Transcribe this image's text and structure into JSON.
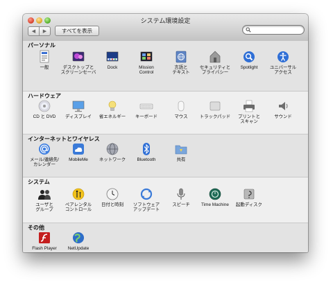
{
  "window": {
    "title": "システム環境設定"
  },
  "toolbar": {
    "back_glyph": "◀",
    "forward_glyph": "▶",
    "show_all_label": "すべてを表示",
    "search_value": ""
  },
  "sections": [
    {
      "title": "パーソナル",
      "items": [
        {
          "label": "一般",
          "icon": "general-icon"
        },
        {
          "label": "デスクトップと\nスクリーンセーバ",
          "icon": "desktop-screensaver-icon"
        },
        {
          "label": "Dock",
          "icon": "dock-icon"
        },
        {
          "label": "Mission\nControl",
          "icon": "mission-control-icon"
        },
        {
          "label": "言語と\nテキスト",
          "icon": "language-text-icon"
        },
        {
          "label": "セキュリティと\nプライバシー",
          "icon": "security-icon"
        },
        {
          "label": "Spotlight",
          "icon": "spotlight-icon"
        },
        {
          "label": "ユニバーサル\nアクセス",
          "icon": "universal-access-icon"
        }
      ]
    },
    {
      "title": "ハードウェア",
      "items": [
        {
          "label": "CD と DVD",
          "icon": "cd-dvd-icon"
        },
        {
          "label": "ディスプレイ",
          "icon": "display-icon"
        },
        {
          "label": "省エネルギー",
          "icon": "energy-saver-icon"
        },
        {
          "label": "キーボード",
          "icon": "keyboard-icon"
        },
        {
          "label": "マウス",
          "icon": "mouse-icon"
        },
        {
          "label": "トラックパッド",
          "icon": "trackpad-icon"
        },
        {
          "label": "プリントと\nスキャン",
          "icon": "print-scan-icon"
        },
        {
          "label": "サウンド",
          "icon": "sound-icon"
        }
      ]
    },
    {
      "title": "インターネットとワイヤレス",
      "items": [
        {
          "label": "メール/連絡先/\nカレンダー",
          "icon": "mail-contacts-icon"
        },
        {
          "label": "MobileMe",
          "icon": "mobileme-icon"
        },
        {
          "label": "ネットワーク",
          "icon": "network-icon"
        },
        {
          "label": "Bluetooth",
          "icon": "bluetooth-icon"
        },
        {
          "label": "共有",
          "icon": "sharing-icon"
        }
      ]
    },
    {
      "title": "システム",
      "items": [
        {
          "label": "ユーザと\nグループ",
          "icon": "users-groups-icon"
        },
        {
          "label": "ペアレンタル\nコントロール",
          "icon": "parental-controls-icon"
        },
        {
          "label": "日付と時刻",
          "icon": "date-time-icon"
        },
        {
          "label": "ソフトウェア\nアップデート",
          "icon": "software-update-icon"
        },
        {
          "label": "スピーチ",
          "icon": "speech-icon"
        },
        {
          "label": "Time Machine",
          "icon": "time-machine-icon"
        },
        {
          "label": "起動ディスク",
          "icon": "startup-disk-icon"
        }
      ]
    },
    {
      "title": "その他",
      "items": [
        {
          "label": "Flash Player",
          "icon": "flash-player-icon"
        },
        {
          "label": "NetUpdate",
          "icon": "netupdate-icon"
        }
      ]
    }
  ]
}
